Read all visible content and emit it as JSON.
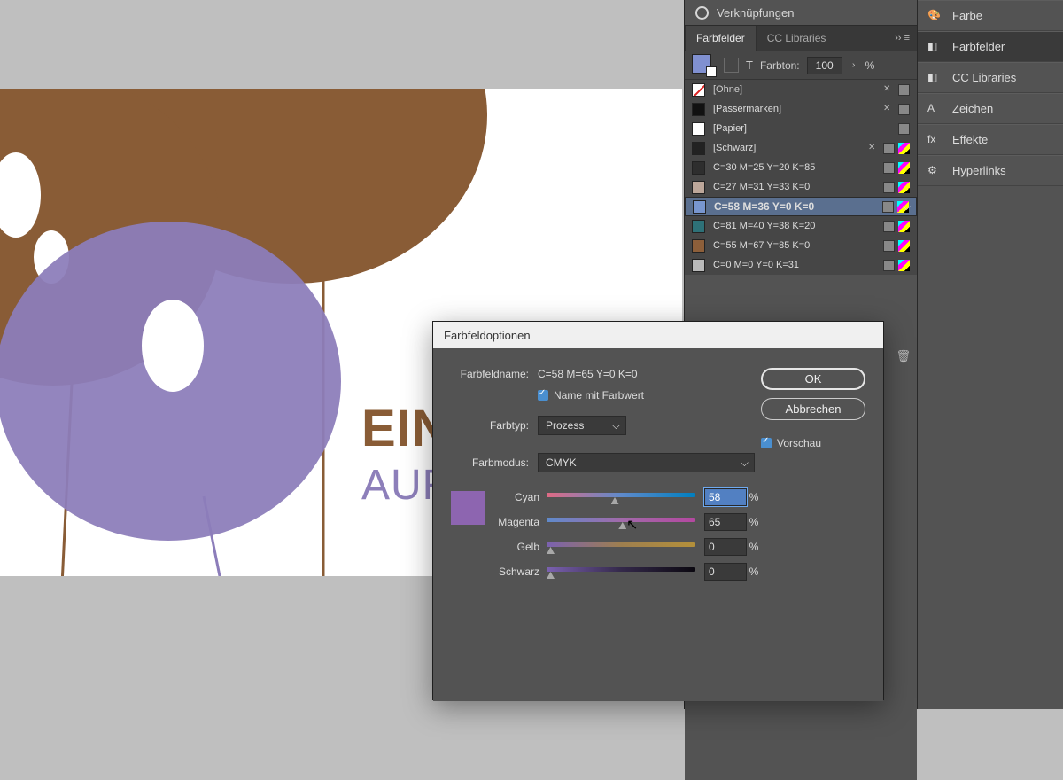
{
  "rail": {
    "items": [
      {
        "label": "Verknüpfungen"
      },
      {
        "label": "Farbe"
      },
      {
        "label": "Farbfelder"
      },
      {
        "label": "CC Libraries"
      },
      {
        "label": "Zeichen"
      },
      {
        "label": "Effekte"
      },
      {
        "label": "Hyperlinks"
      }
    ]
  },
  "panel": {
    "tab_swatches": "Farbfelder",
    "tab_cc": "CC Libraries",
    "tint_label": "Farbton:",
    "tint_value": "100",
    "pct": "%",
    "swatches": [
      {
        "name": "[Ohne]",
        "selected": false,
        "locked": true,
        "cmyk": false,
        "fill": "none"
      },
      {
        "name": "[Passermarken]",
        "selected": false,
        "locked": true,
        "cmyk": false,
        "fill": "#111"
      },
      {
        "name": "[Papier]",
        "selected": false,
        "locked": false,
        "cmyk": false,
        "fill": "#fff"
      },
      {
        "name": "[Schwarz]",
        "selected": false,
        "locked": true,
        "cmyk": true,
        "fill": "#222"
      },
      {
        "name": "C=30 M=25 Y=20 K=85",
        "selected": false,
        "locked": false,
        "cmyk": true,
        "fill": "#2e2e2e"
      },
      {
        "name": "C=27 M=31 Y=33 K=0",
        "selected": false,
        "locked": false,
        "cmyk": true,
        "fill": "#bda79a"
      },
      {
        "name": "C=58 M=36 Y=0 K=0",
        "selected": true,
        "locked": false,
        "cmyk": true,
        "fill": "#7896cf"
      },
      {
        "name": "C=81 M=40 Y=38 K=20",
        "selected": false,
        "locked": false,
        "cmyk": true,
        "fill": "#2e7178"
      },
      {
        "name": "C=55 M=67 Y=85 K=0",
        "selected": false,
        "locked": false,
        "cmyk": true,
        "fill": "#8d5f3a"
      },
      {
        "name": "C=0 M=0 Y=0 K=31",
        "selected": false,
        "locked": false,
        "cmyk": true,
        "fill": "#b9b9b9"
      }
    ]
  },
  "dialog": {
    "title": "Farbfeldoptionen",
    "name_label": "Farbfeldname:",
    "name_value": "C=58 M=65 Y=0 K=0",
    "name_with_value": "Name mit Farbwert",
    "type_label": "Farbtyp:",
    "type_value": "Prozess",
    "mode_label": "Farbmodus:",
    "mode_value": "CMYK",
    "channels": [
      {
        "label": "Cyan",
        "value": "58",
        "grad": "linear-gradient(90deg,#e06a84,#5f8acb,#007fbf)",
        "pos": 58,
        "focused": true
      },
      {
        "label": "Magenta",
        "value": "65",
        "grad": "linear-gradient(90deg,#5f8acb,#a16aaa,#b448a0)",
        "pos": 65,
        "focused": false
      },
      {
        "label": "Gelb",
        "value": "0",
        "grad": "linear-gradient(90deg,#7b61b1,#9e7f4f,#b4903a)",
        "pos": 0,
        "focused": false
      },
      {
        "label": "Schwarz",
        "value": "0",
        "grad": "linear-gradient(90deg,#7b61b1,#34294a,#0b0810)",
        "pos": 0,
        "focused": false
      }
    ],
    "ok": "OK",
    "cancel": "Abbrechen",
    "preview": "Vorschau",
    "pct": "%"
  },
  "art": {
    "line1": "EIN",
    "line2": "AUF"
  },
  "top_link": "Verknüpfungen"
}
